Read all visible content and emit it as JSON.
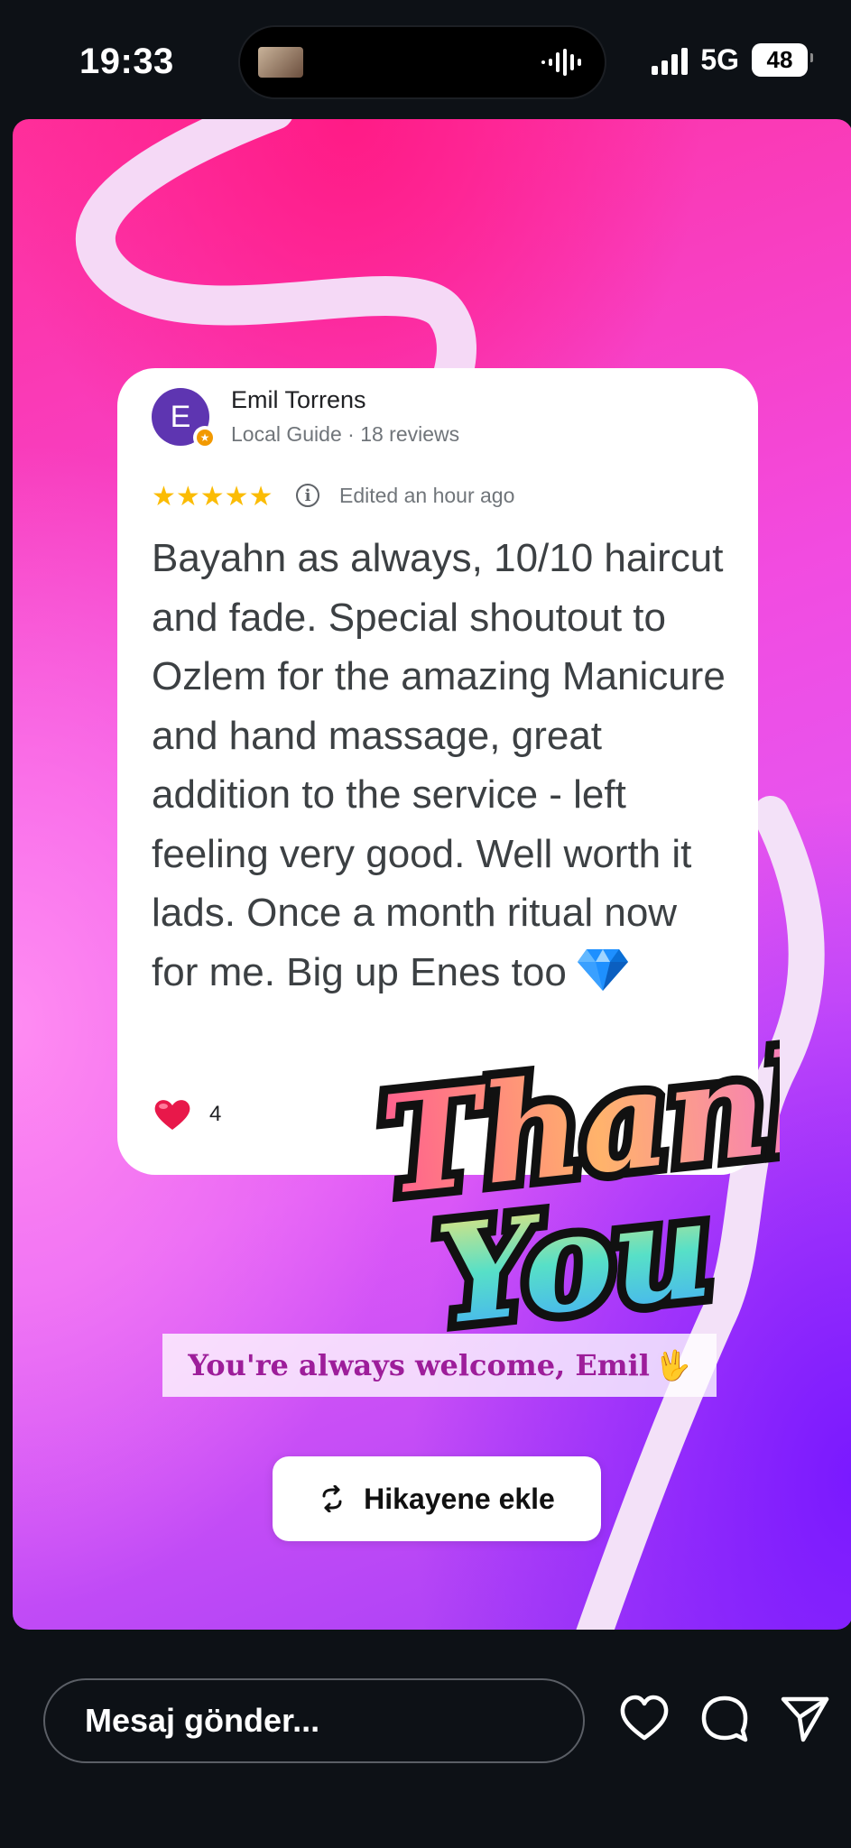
{
  "status_bar": {
    "time": "19:33",
    "network": "5G",
    "battery": "48"
  },
  "review": {
    "avatar_letter": "E",
    "reviewer_name": "Emil Torrens",
    "reviewer_meta": "Local Guide · 18 reviews",
    "stars": "★★★★★",
    "rating": 5,
    "edited": "Edited an hour ago",
    "text": "Bayahn as always, 10/10 haircut and fade. Special shoutout to Ozlem for the amazing Manicure and hand massage, great addition to the service - left feeling very good. Well worth it lads. Once a month ritual now for me. Big up Enes too",
    "likes": "4"
  },
  "sticker": {
    "line1": "Thank",
    "line2": "You"
  },
  "caption": {
    "text": "You're always welcome, Emil",
    "emoji": "🖖"
  },
  "add_story": {
    "label": "Hikayene ekle"
  },
  "message": {
    "placeholder": "Mesaj gönder..."
  },
  "icons": {
    "like": "heart-icon",
    "comment": "comment-bubble-icon",
    "share": "send-icon",
    "add_story": "repost-icon"
  },
  "colors": {
    "background": "#0d1116",
    "story_pink": "#ff2f9b",
    "story_purple": "#7a19ff",
    "caption_text": "#9d1d9a",
    "star": "#fbbc04",
    "avatar": "#5e35b1"
  }
}
